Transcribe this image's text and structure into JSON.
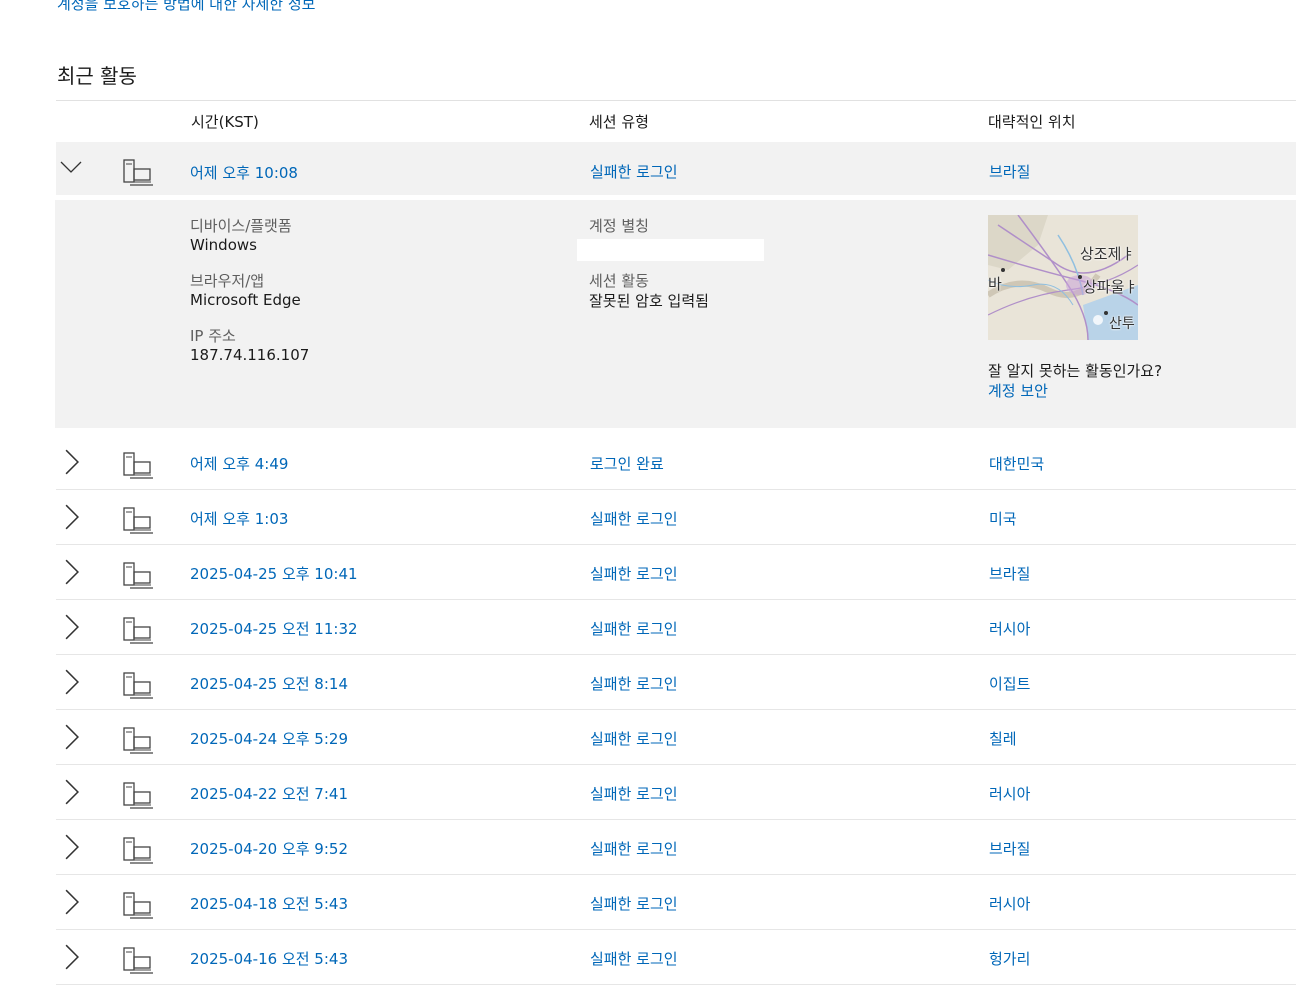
{
  "top_link": "계정을 보호하는 방법에 대한 자세한 정보",
  "section_title": "최근 활동",
  "columns": {
    "time": "시간(KST)",
    "session_type": "세션 유형",
    "location": "대략적인 위치"
  },
  "expanded": {
    "time": "어제 오후 10:08",
    "session_type": "실패한 로그인",
    "location": "브라질",
    "device_label": "디바이스/플랫폼",
    "device_value": "Windows",
    "browser_label": "브라우저/앱",
    "browser_value": "Microsoft Edge",
    "ip_label": "IP 주소",
    "ip_value": "187.74.116.107",
    "alias_label": "계정 별칭",
    "session_activity_label": "세션 활동",
    "session_activity_value": "잘못된 암호 입력됨",
    "map_labels": [
      "상조제ㅑ",
      "바",
      "상파울ㅑ",
      "산투"
    ],
    "unknown_question": "잘 알지 못하는 활동인가요?",
    "secure_link": "계정 보안"
  },
  "rows": [
    {
      "time": "어제 오후 4:49",
      "session_type": "로그인 완료",
      "location": "대한민국"
    },
    {
      "time": "어제 오후 1:03",
      "session_type": "실패한 로그인",
      "location": "미국"
    },
    {
      "time": "2025-04-25 오후 10:41",
      "session_type": "실패한 로그인",
      "location": "브라질"
    },
    {
      "time": "2025-04-25 오전 11:32",
      "session_type": "실패한 로그인",
      "location": "러시아"
    },
    {
      "time": "2025-04-25 오전 8:14",
      "session_type": "실패한 로그인",
      "location": "이집트"
    },
    {
      "time": "2025-04-24 오후 5:29",
      "session_type": "실패한 로그인",
      "location": "칠레"
    },
    {
      "time": "2025-04-22 오전 7:41",
      "session_type": "실패한 로그인",
      "location": "러시아"
    },
    {
      "time": "2025-04-20 오후 9:52",
      "session_type": "실패한 로그인",
      "location": "브라질"
    },
    {
      "time": "2025-04-18 오전 5:43",
      "session_type": "실패한 로그인",
      "location": "러시아"
    },
    {
      "time": "2025-04-16 오전 5:43",
      "session_type": "실패한 로그인",
      "location": "헝가리"
    }
  ],
  "colors": {
    "link": "#0067b8",
    "panel_bg": "#f2f2f2",
    "divider": "#e6e6e6"
  },
  "icons": {
    "expand": "chevron-right-icon",
    "collapse": "chevron-down-icon",
    "device": "computer-device-icon"
  }
}
